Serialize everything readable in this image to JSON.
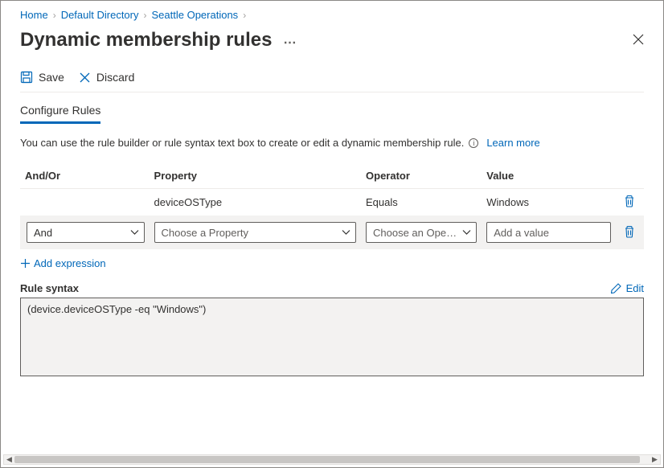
{
  "breadcrumb": {
    "items": [
      "Home",
      "Default Directory",
      "Seattle Operations"
    ]
  },
  "header": {
    "title": "Dynamic membership rules"
  },
  "toolbar": {
    "save_label": "Save",
    "discard_label": "Discard"
  },
  "section": {
    "title": "Configure Rules",
    "help_text": "You can use the rule builder or rule syntax text box to create or edit a dynamic membership rule.",
    "learn_more_label": "Learn more"
  },
  "table": {
    "headers": {
      "andor": "And/Or",
      "property": "Property",
      "operator": "Operator",
      "value": "Value"
    },
    "rows": [
      {
        "andor": "",
        "property": "deviceOSType",
        "operator": "Equals",
        "value": "Windows"
      }
    ],
    "input_row": {
      "andor": "And",
      "property_placeholder": "Choose a Property",
      "operator_placeholder": "Choose an Ope…",
      "value_placeholder": "Add a value"
    }
  },
  "add_expression_label": "Add expression",
  "syntax": {
    "label": "Rule syntax",
    "edit_label": "Edit",
    "value": "(device.deviceOSType -eq \"Windows\")"
  }
}
